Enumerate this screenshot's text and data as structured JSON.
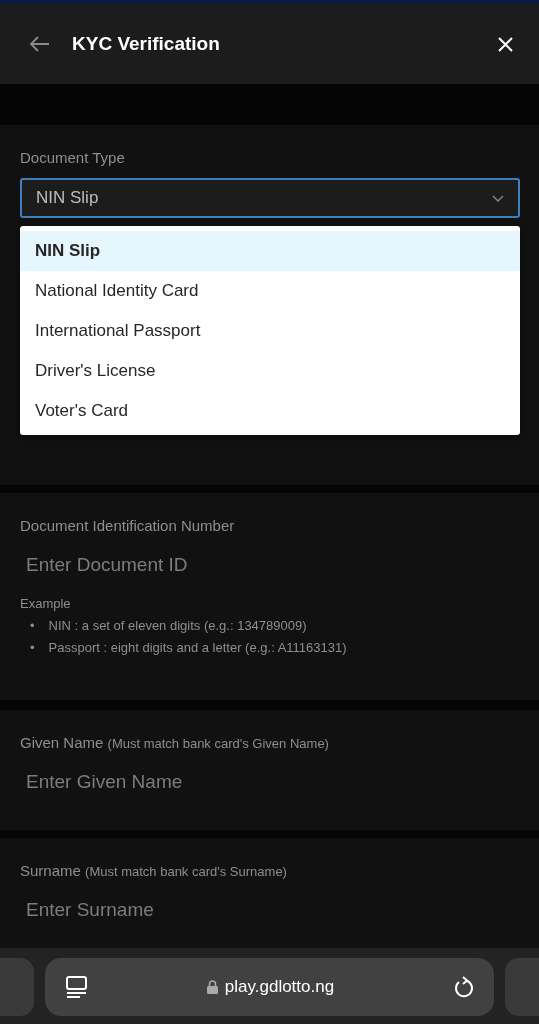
{
  "header": {
    "title": "KYC Verification"
  },
  "document_type": {
    "label": "Document Type",
    "value": "NIN Slip",
    "expanded": true,
    "options": [
      {
        "label": "NIN Slip",
        "selected": true
      },
      {
        "label": "National Identity Card",
        "selected": false
      },
      {
        "label": "International Passport",
        "selected": false
      },
      {
        "label": "Driver's License",
        "selected": false
      },
      {
        "label": "Voter's Card",
        "selected": false
      }
    ]
  },
  "document_id": {
    "label": "Document Identification Number",
    "placeholder": "Enter Document ID",
    "example_title": "Example",
    "examples": [
      {
        "bullet": "•",
        "text": "NIN : a set of eleven digits (e.g.: 134789009)"
      },
      {
        "bullet": "•",
        "text": "Passport : eight digits and a letter (e.g.: A11163131)"
      }
    ]
  },
  "given_name": {
    "label": "Given Name",
    "hint": "(Must match bank card's Given Name)",
    "placeholder": "Enter Given Name"
  },
  "surname": {
    "label": "Surname",
    "hint": "(Must match bank card's Surname)",
    "placeholder": "Enter Surname"
  },
  "browser": {
    "url": "play.gdlotto.ng"
  }
}
